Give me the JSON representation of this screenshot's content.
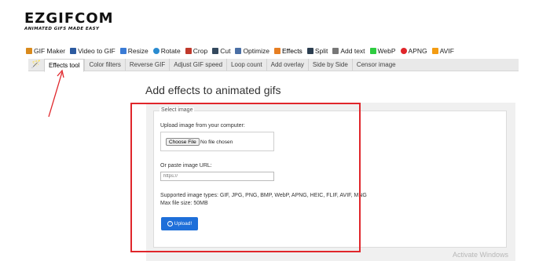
{
  "logo": {
    "main": "EZGIFCOM",
    "tagline": "ANIMATED GIFS MADE EASY"
  },
  "main_nav": [
    {
      "label": "GIF Maker",
      "icon": "gif-maker-icon",
      "color": "#d98a1c"
    },
    {
      "label": "Video to GIF",
      "icon": "video-icon",
      "color": "#2c5aa0"
    },
    {
      "label": "Resize",
      "icon": "resize-icon",
      "color": "#3a7bd5"
    },
    {
      "label": "Rotate",
      "icon": "rotate-icon",
      "color": "#2a8bd0"
    },
    {
      "label": "Crop",
      "icon": "crop-icon",
      "color": "#c0392b"
    },
    {
      "label": "Cut",
      "icon": "cut-icon",
      "color": "#34495e"
    },
    {
      "label": "Optimize",
      "icon": "optimize-icon",
      "color": "#4a6fa5"
    },
    {
      "label": "Effects",
      "icon": "effects-icon",
      "color": "#e67e22"
    },
    {
      "label": "Split",
      "icon": "split-icon",
      "color": "#2c3e50"
    },
    {
      "label": "Add text",
      "icon": "text-icon",
      "color": "#555555"
    },
    {
      "label": "WebP",
      "icon": "webp-icon",
      "color": "#2ecc40"
    },
    {
      "label": "APNG",
      "icon": "apng-icon",
      "color": "#e0262b"
    },
    {
      "label": "AVIF",
      "icon": "avif-icon",
      "color": "#f39c12"
    }
  ],
  "sub_nav": {
    "tabs": [
      "Effects tool",
      "Color filters",
      "Reverse GIF",
      "Adjust GIF speed",
      "Loop count",
      "Add overlay",
      "Side by Side",
      "Censor image"
    ]
  },
  "page": {
    "title": "Add effects to animated gifs",
    "legend": "Select image",
    "upload_label": "Upload image from your computer:",
    "choose_file": "Choose File",
    "no_file": "No file chosen",
    "url_label": "Or paste image URL:",
    "url_placeholder": "https://",
    "supported": "Supported image types: GIF, JPG, PNG, BMP, WebP, APNG, HEIC, FLIF, AVIF, MNG",
    "max_size": "Max file size: 50MB",
    "upload_button": "Upload!"
  },
  "watermark": "Activate Windows",
  "colors": {
    "highlight": "#e0262b",
    "upload_button": "#1e6fd9"
  }
}
